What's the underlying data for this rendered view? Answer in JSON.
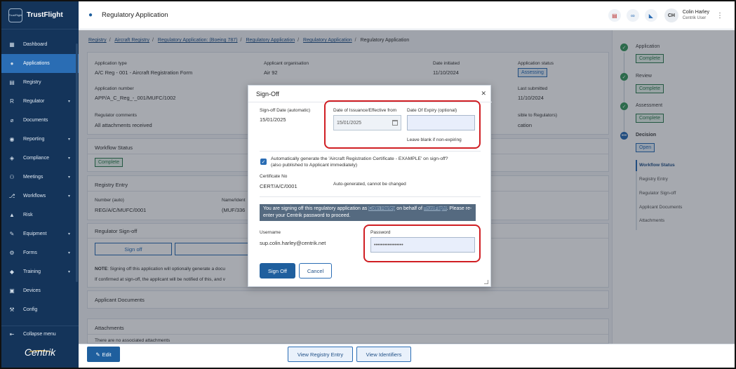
{
  "app": {
    "name": "TrustFlight",
    "logo_text": "TrustFlight",
    "brand": "Centrik"
  },
  "sidebar": {
    "items": [
      {
        "label": "Dashboard",
        "icon": "dashboard-icon",
        "glyph": "▦"
      },
      {
        "label": "Applications",
        "icon": "user-icon",
        "glyph": "●"
      },
      {
        "label": "Registry",
        "icon": "registry-icon",
        "glyph": "▤"
      },
      {
        "label": "Regulator",
        "icon": "regulator-icon",
        "glyph": "R"
      },
      {
        "label": "Documents",
        "icon": "paperclip-icon",
        "glyph": "⌀"
      },
      {
        "label": "Reporting",
        "icon": "reporting-icon",
        "glyph": "◉"
      },
      {
        "label": "Compliance",
        "icon": "compliance-icon",
        "glyph": "◈"
      },
      {
        "label": "Meetings",
        "icon": "meetings-icon",
        "glyph": "⚇"
      },
      {
        "label": "Workflows",
        "icon": "workflows-icon",
        "glyph": "⎇"
      },
      {
        "label": "Risk",
        "icon": "risk-icon",
        "glyph": "▲"
      },
      {
        "label": "Equipment",
        "icon": "wrench-icon",
        "glyph": "✎"
      },
      {
        "label": "Forms",
        "icon": "forms-icon",
        "glyph": "⚙"
      },
      {
        "label": "Training",
        "icon": "graduation-icon",
        "glyph": "◆"
      },
      {
        "label": "Devices",
        "icon": "devices-icon",
        "glyph": "▣"
      },
      {
        "label": "Config",
        "icon": "config-icon",
        "glyph": "⚒"
      }
    ],
    "collapse_label": "Collapse menu"
  },
  "header": {
    "title": "Regulatory Application",
    "user_initials": "CH",
    "user_name": "Colin Harley",
    "user_role": "Centrik User"
  },
  "breadcrumb": {
    "items": [
      "Registry",
      "Aircraft Registry",
      "Regulatory Application: (Boeing 787)",
      "Regulatory Application",
      "Regulatory Application"
    ],
    "current": "Regulatory Application"
  },
  "application": {
    "type_label": "Application type",
    "type_value": "A/C Reg - 001 - Aircraft Registration Form",
    "org_label": "Applicant organisation",
    "org_value": "Air 92",
    "date_label": "Date initiated",
    "date_value": "11/10/2024",
    "status_label": "Application status",
    "status_value": "Assessing",
    "number_label": "Application number",
    "number_value": "APP/A_C_Reg_-_001/MUFC/1002",
    "last_label": "Last submitted",
    "last_value": "11/10/2024",
    "comments_label": "Regulator comments",
    "comments_value": "All attachments received",
    "visible_label": "sible to Regulators)",
    "visible_value": "cation"
  },
  "workflow": {
    "title": "Workflow Status",
    "status": "Complete"
  },
  "registry_entry": {
    "title": "Registry Entry",
    "number_label": "Number (auto)",
    "number_value": "REG/A/C/MUFC/0001",
    "name_label": "Name/Ident",
    "name_value": "(MUF/336"
  },
  "regulator_signoff": {
    "title": "Regulator Sign-off",
    "sign_off_btn": "Sign off",
    "note_bold": "NOTE",
    "note_text": ": Signing off this application will optionally generate a docu",
    "confirm_text": "If confirmed at sign-off, the applicant will be notified of this, and v"
  },
  "applicant_documents": {
    "title": "Applicant Documents"
  },
  "attachments": {
    "title": "Attachments",
    "empty_text": "There are no associated attachments"
  },
  "footer": {
    "edit_label": "Edit",
    "view_registry_label": "View Registry Entry",
    "view_identifiers_label": "View Identifiers"
  },
  "steps": [
    {
      "label": "Application",
      "status": "Complete"
    },
    {
      "label": "Review",
      "status": "Complete"
    },
    {
      "label": "Assessment",
      "status": "Complete"
    },
    {
      "label": "Decision",
      "status": "Open"
    }
  ],
  "subnav": [
    "Workflow Status",
    "Registry Entry",
    "Regulator Sign-off",
    "Applicant Documents",
    "Attachments"
  ],
  "modal": {
    "title": "Sign-Off",
    "signoff_date_label": "Sign-off Date (automatic)",
    "signoff_date_value": "15/01/2025",
    "issuance_label": "Date of Issuance/Effective from",
    "issuance_value": "15/01/2025",
    "expiry_label": "Date Of Expiry (optional)",
    "expiry_value": "",
    "expiry_hint": "Leave blank if non-expiring",
    "auto_generate_text": "Automatically generate the 'Aircraft Registration Certificate - EXAMPLE' on sign-off?",
    "auto_generate_sub": "(also published to Applicant immediately)",
    "certificate_label": "Certificate No",
    "certificate_value": "CERT/A/C/0001",
    "certificate_note": "Auto-generated, cannot be changed",
    "banner_pre": "You are signing off this regulatory application as",
    "banner_name1": "Colin Harley",
    "banner_mid": "on behalf of",
    "banner_name2": "TrustFlight",
    "banner_post": ". Please re-enter your Centrik password to proceed.",
    "username_label": "Username",
    "username_value": "sup.colin.harley@centrik.net",
    "password_label": "Password",
    "password_value": "•••••••••••••••••",
    "sign_off_btn": "Sign Off",
    "cancel_btn": "Cancel"
  },
  "colors": {
    "primary": "#1f5f9e",
    "sidebar": "#14345a",
    "success": "#3a9a5e",
    "highlight": "#d01e23"
  }
}
